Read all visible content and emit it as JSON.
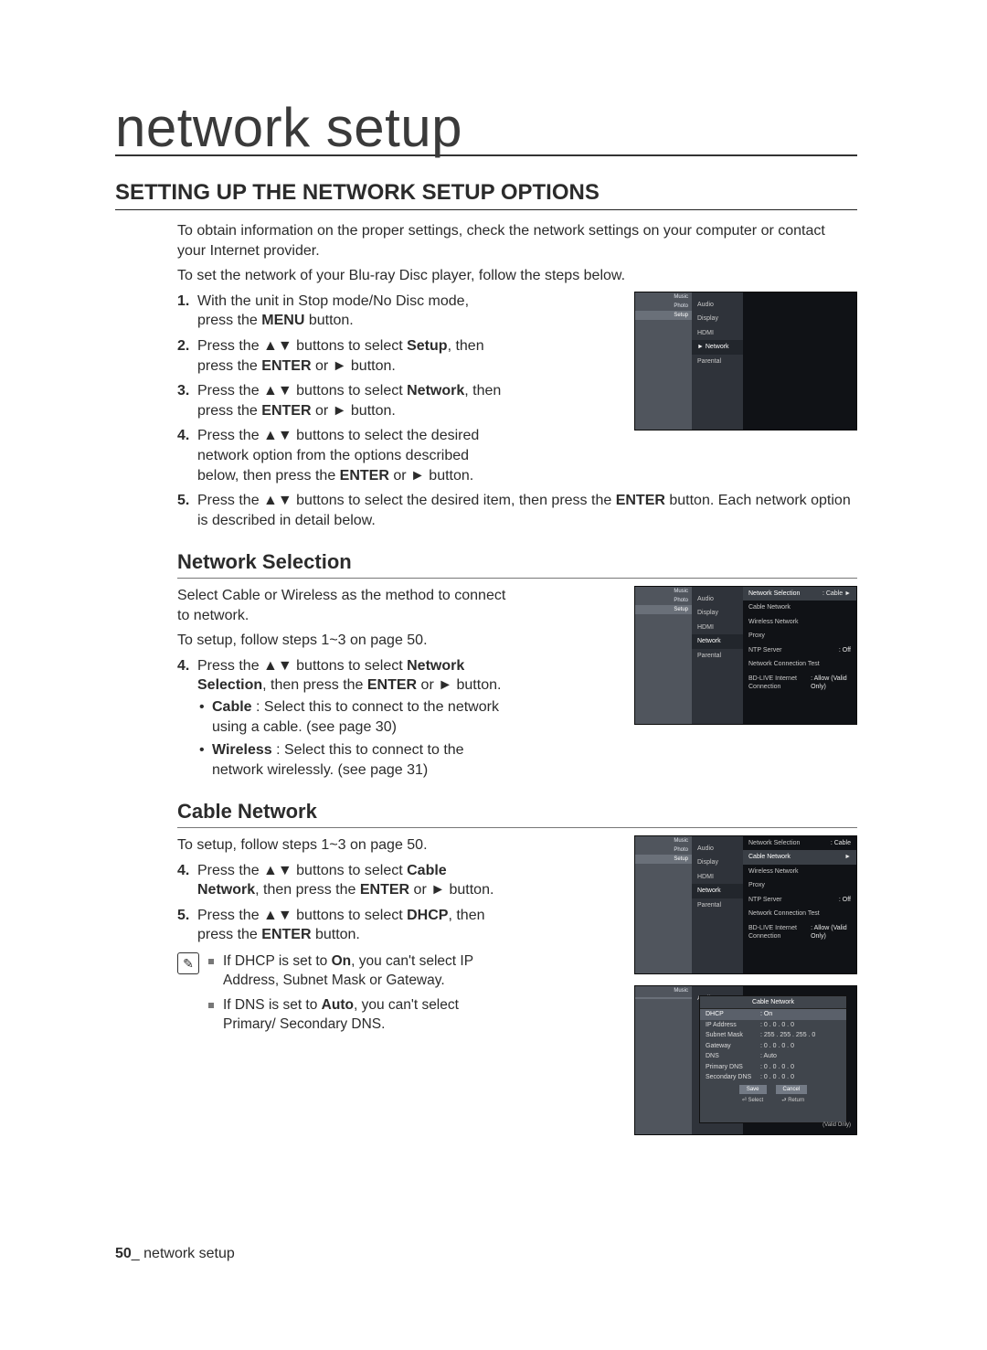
{
  "title": "network setup",
  "section_heading": "SETTING UP THE NETWORK SETUP OPTIONS",
  "intro": {
    "p1": "To obtain information on the proper settings, check the network settings on your computer or contact your Internet provider.",
    "p2": "To set the network of your Blu-ray Disc player, follow the steps below."
  },
  "steps_main": [
    {
      "num": "1.",
      "html": "With the unit in Stop mode/No Disc mode, press the <b>MENU</b> button."
    },
    {
      "num": "2.",
      "html": "Press the ▲▼ buttons to select <b>Setup</b>, then press the <b>ENTER</b> or ► button."
    },
    {
      "num": "3.",
      "html": "Press the ▲▼ buttons to select <b>Network</b>, then press the <b>ENTER</b> or ► button."
    },
    {
      "num": "4.",
      "html": "Press the ▲▼ buttons to select the desired network option from the options described below, then press the <b>ENTER</b> or ► button."
    },
    {
      "num": "5.",
      "html": "Press the ▲▼ buttons to select the desired item, then press the <b>ENTER</b> button. Each network option is described in detail below."
    }
  ],
  "sub1": {
    "heading": "Network Selection",
    "p1": "Select Cable or Wireless as the method to connect to network.",
    "p2": "To setup, follow steps 1~3 on page 50.",
    "step4": {
      "num": "4.",
      "html": "Press the ▲▼ buttons to select <b>Network Selection</b>, then press the <b>ENTER</b> or ► button."
    },
    "bullets": [
      {
        "html": "<b>Cable</b> : Select this to connect to the network using a cable. (see page 30)"
      },
      {
        "html": "<b>Wireless</b> : Select this to connect to the network wirelessly. (see page 31)"
      }
    ]
  },
  "sub2": {
    "heading": "Cable Network",
    "p1": "To setup, follow steps 1~3 on page 50.",
    "steps": [
      {
        "num": "4.",
        "html": "Press the ▲▼ buttons to select <b>Cable Network</b>, then press the <b>ENTER</b> or ► button."
      },
      {
        "num": "5.",
        "html": "Press the ▲▼ buttons to select <b>DHCP</b>, then press the <b>ENTER</b> button."
      }
    ],
    "notes": [
      {
        "html": "If DHCP is set to <b>On</b>, you can't select IP Address, Subnet Mask or Gateway."
      },
      {
        "html": "If DNS is set to <b>Auto</b>, you can't select Primary/ Secondary DNS."
      }
    ]
  },
  "footer": {
    "page": "50",
    "sep": "_",
    "label": " network setup"
  },
  "ui": {
    "sidebar": {
      "music": "Music",
      "photo": "Photo",
      "setup": "Setup"
    },
    "menu": {
      "audio": "Audio",
      "display": "Display",
      "hdmi": "HDMI",
      "network": "Network",
      "parental": "Parental"
    },
    "net": {
      "network_selection": "Network Selection",
      "cable_network": "Cable Network",
      "wireless_network": "Wireless Network",
      "proxy": "Proxy",
      "ntp_server": "NTP Server",
      "net_conn_test": "Network Connection Test",
      "bdlive": "BD-LIVE Internet Connection",
      "val_cable": "Cable",
      "val_off": "Off",
      "val_allow": "Allow (Valid Only)"
    },
    "popup": {
      "title": "Cable Network",
      "dhcp": "DHCP",
      "dhcp_v": "On",
      "ip": "IP Address",
      "ip_v": "0 . 0 . 0 . 0",
      "subnet": "Subnet Mask",
      "subnet_v": "255 . 255 . 255 . 0",
      "gateway": "Gateway",
      "gateway_v": "0 . 0 . 0 . 0",
      "dns": "DNS",
      "dns_v": "Auto",
      "pdns": "Primary DNS",
      "pdns_v": "0 . 0 . 0 . 0",
      "sdns": "Secondary DNS",
      "sdns_v": "0 . 0 . 0 . 0",
      "save": "Save",
      "cancel": "Cancel",
      "select": "Select",
      "return": "Return",
      "tag": "(Valid Only)"
    }
  }
}
